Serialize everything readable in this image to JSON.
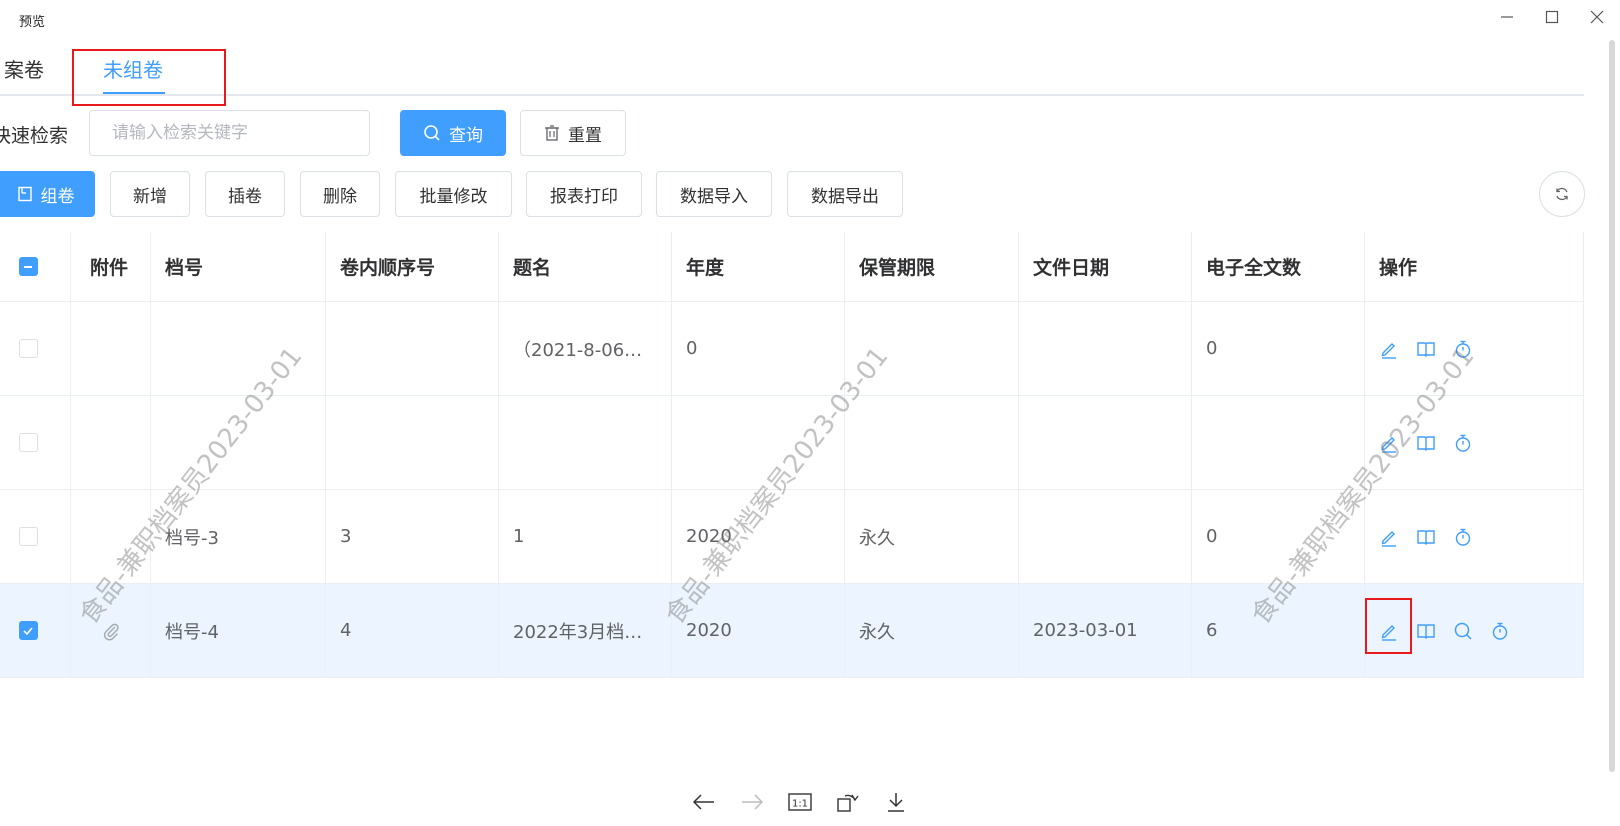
{
  "window": {
    "title": "预览"
  },
  "tabs": [
    {
      "label": "案卷",
      "active": false
    },
    {
      "label": "未组卷",
      "active": true
    }
  ],
  "search": {
    "label": "快速检索",
    "placeholder": "请输入检索关键字",
    "value": "",
    "query_label": "查询",
    "reset_label": "重置"
  },
  "toolbar": {
    "group_label": "组卷",
    "add_label": "新增",
    "insert_label": "插卷",
    "delete_label": "删除",
    "batch_edit_label": "批量修改",
    "report_print_label": "报表打印",
    "import_label": "数据导入",
    "export_label": "数据导出"
  },
  "table": {
    "columns": [
      "附件",
      "档号",
      "卷内顺序号",
      "题名",
      "年度",
      "保管期限",
      "文件日期",
      "电子全文数",
      "操作"
    ],
    "rows": [
      {
        "checked": false,
        "attachment": false,
        "archive_no": "",
        "seq": "",
        "title": "（2021-8-06…",
        "year": "0",
        "retention": "",
        "date": "",
        "ecount": "0",
        "ops": [
          "edit",
          "book",
          "stopwatch"
        ]
      },
      {
        "checked": false,
        "attachment": false,
        "archive_no": "",
        "seq": "",
        "title": "",
        "year": "",
        "retention": "",
        "date": "",
        "ecount": "",
        "ops": [
          "edit",
          "book",
          "stopwatch"
        ]
      },
      {
        "checked": false,
        "attachment": false,
        "archive_no": "档号-3",
        "seq": "3",
        "title": "1",
        "year": "2020",
        "retention": "永久",
        "date": "",
        "ecount": "0",
        "ops": [
          "edit",
          "book",
          "stopwatch"
        ]
      },
      {
        "checked": true,
        "attachment": true,
        "archive_no": "档号-4",
        "seq": "4",
        "title": "2022年3月档…",
        "year": "2020",
        "retention": "永久",
        "date": "2023-03-01",
        "ecount": "6",
        "ops": [
          "edit",
          "book",
          "search",
          "stopwatch"
        ]
      }
    ]
  },
  "watermark": {
    "text": "食品-兼职档案员2023-03-01"
  },
  "colors": {
    "accent": "#409eff",
    "annotation": "#e81919",
    "selected_row": "#ecf5ff"
  }
}
